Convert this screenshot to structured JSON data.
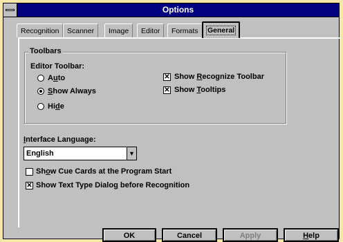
{
  "window": {
    "title": "Options"
  },
  "tabs": [
    {
      "label": "Recognition"
    },
    {
      "label": "Scanner"
    },
    {
      "label": "Image"
    },
    {
      "label": "Editor"
    },
    {
      "label": "Formats"
    },
    {
      "label": "General",
      "active": true
    }
  ],
  "toolbars": {
    "group_label": "Toolbars",
    "editor_toolbar_label": "Editor Toolbar:",
    "options": [
      {
        "pre": "A",
        "u": "u",
        "post": "to",
        "selected": false
      },
      {
        "pre": "",
        "u": "S",
        "post": "how Always",
        "selected": true
      },
      {
        "pre": "Hi",
        "u": "d",
        "post": "e",
        "selected": false
      }
    ],
    "show_recognize": {
      "pre": "Show ",
      "u": "R",
      "post": "ecognize Toolbar",
      "checked": true
    },
    "show_tooltips": {
      "pre": "Show ",
      "u": "T",
      "post": "ooltips",
      "checked": true
    }
  },
  "interface_language": {
    "label_u": "I",
    "label_rest": "nterface Language:",
    "value": "English"
  },
  "cue_cards": {
    "pre": "Sh",
    "u": "o",
    "post": "w Cue Cards at the Program Start",
    "checked": false
  },
  "text_type": {
    "pre": "Show Text Type  Dialo",
    "u": "g",
    "post": " before Recognition",
    "checked": true
  },
  "buttons": {
    "ok": "OK",
    "cancel": "Cancel",
    "apply": "Apply",
    "help_u": "H",
    "help_rest": "elp"
  },
  "check_mark": "✕",
  "combo_arrow": "▼",
  "colors": {
    "title_bar": "#000080",
    "face": "#c0c0c0",
    "desktop": "#f4e7a8"
  }
}
